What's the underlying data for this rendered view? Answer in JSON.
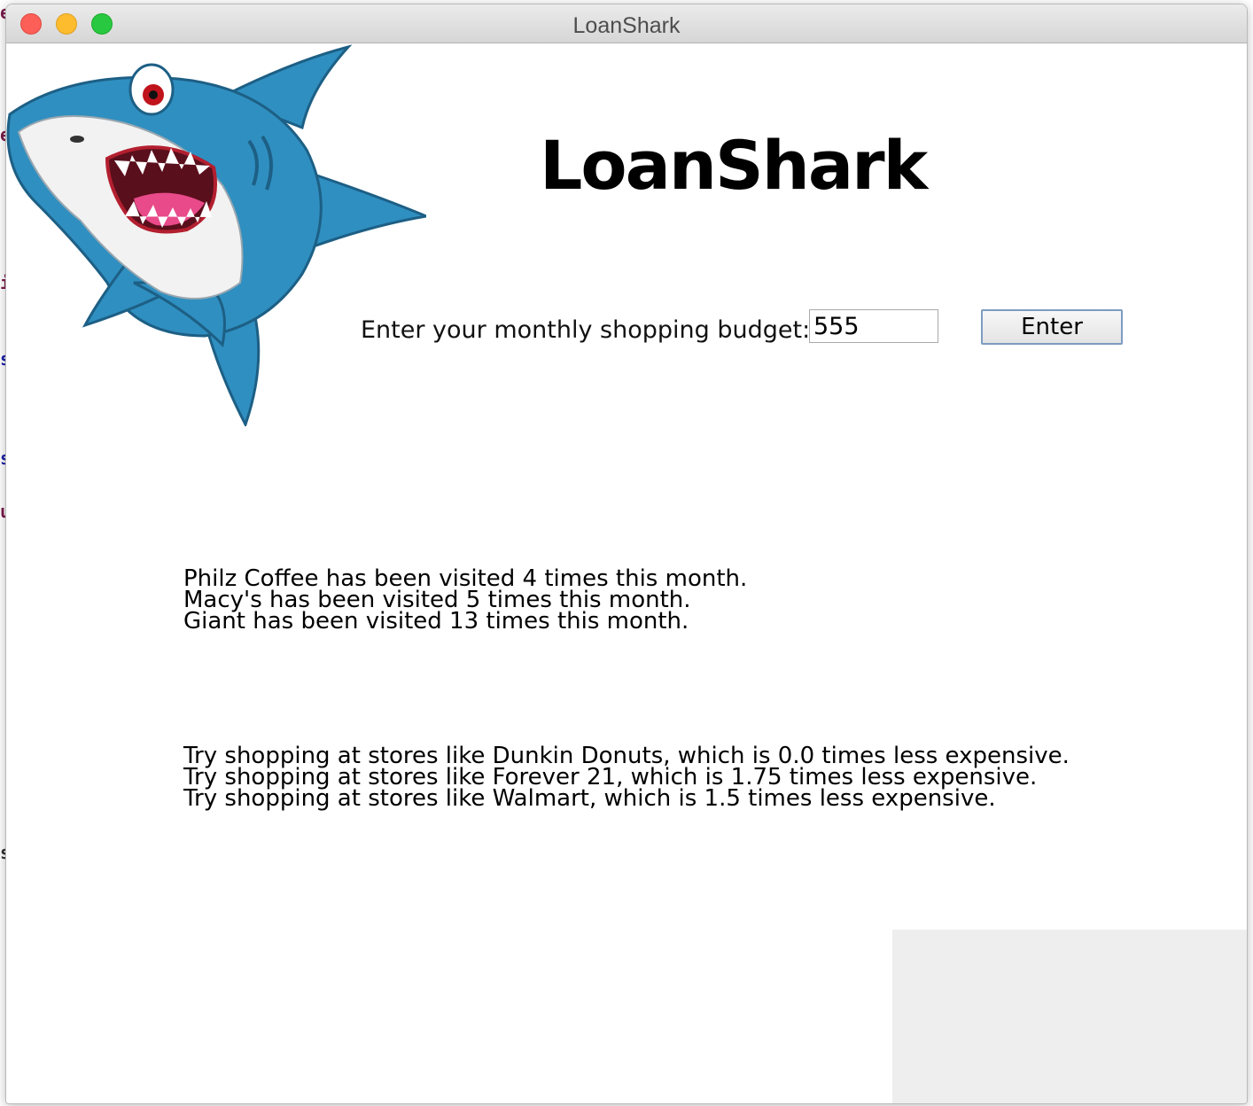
{
  "window": {
    "title": "LoanShark"
  },
  "header": {
    "app_title": "LoanShark"
  },
  "budget": {
    "label": "Enter your monthly shopping budget:",
    "value": "555",
    "button_label": "Enter"
  },
  "visits": [
    "Philz Coffee has been visited 4 times this month.",
    "Macy's has been visited 5 times this month.",
    "Giant has been visited 13 times this month."
  ],
  "suggestions": [
    "Try shopping at stores like Dunkin Donuts, which is 0.0 times less expensive.",
    "Try shopping at stores like Forever 21, which is 1.75 times less expensive.",
    "Try shopping at stores like Walmart, which is 1.5 times less expensive."
  ],
  "icons": {
    "close": "close-window-icon",
    "minimize": "minimize-window-icon",
    "maximize": "maximize-window-icon",
    "mascot": "shark-mascot-icon"
  },
  "colors": {
    "shark_body": "#2f8fc0",
    "shark_belly": "#f2f2f2",
    "mouth": "#e84a8a",
    "button_border": "#7d9cc2",
    "grey_panel": "#eeeeee"
  }
}
